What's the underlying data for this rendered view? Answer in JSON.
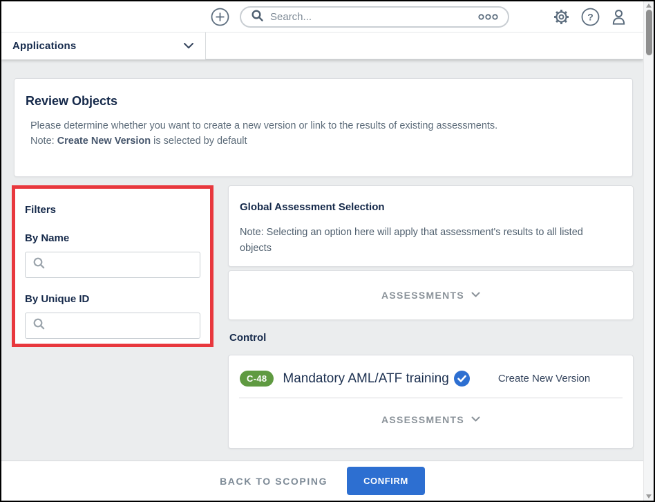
{
  "topbar": {
    "search_placeholder": "Search...",
    "icons": {
      "add": "plus-circle",
      "search": "magnifier",
      "more": "ellipsis-ooo",
      "settings": "gear",
      "help": "question-circle",
      "user": "person-silhouette"
    }
  },
  "appbar": {
    "selector_label": "Applications"
  },
  "review": {
    "title": "Review Objects",
    "description": "Please determine whether you want to create a new version or link to the results of existing assessments.",
    "note_prefix": "Note: ",
    "note_bold": "Create New Version",
    "note_suffix": " is selected by default"
  },
  "filters": {
    "title": "Filters",
    "by_name_label": "By Name",
    "by_name_value": "",
    "by_unique_id_label": "By Unique ID",
    "by_unique_id_value": ""
  },
  "global_assessment": {
    "title": "Global Assessment Selection",
    "note": "Note: Selecting an option here will apply that assessment's results to all listed objects",
    "dropdown_label": "ASSESSMENTS"
  },
  "control_section": {
    "label": "Control",
    "item": {
      "badge": "C-48",
      "title": "Mandatory AML/ATF training",
      "selected_option": "Create New Version",
      "selected": true
    },
    "dropdown_label": "ASSESSMENTS"
  },
  "footer": {
    "back_label": "BACK TO SCOPING",
    "confirm_label": "CONFIRM"
  },
  "colors": {
    "accent_blue": "#2d6fd1",
    "badge_green": "#5f9a41",
    "highlight_red": "#e8383d",
    "icon_slate": "#5c6d7e"
  }
}
